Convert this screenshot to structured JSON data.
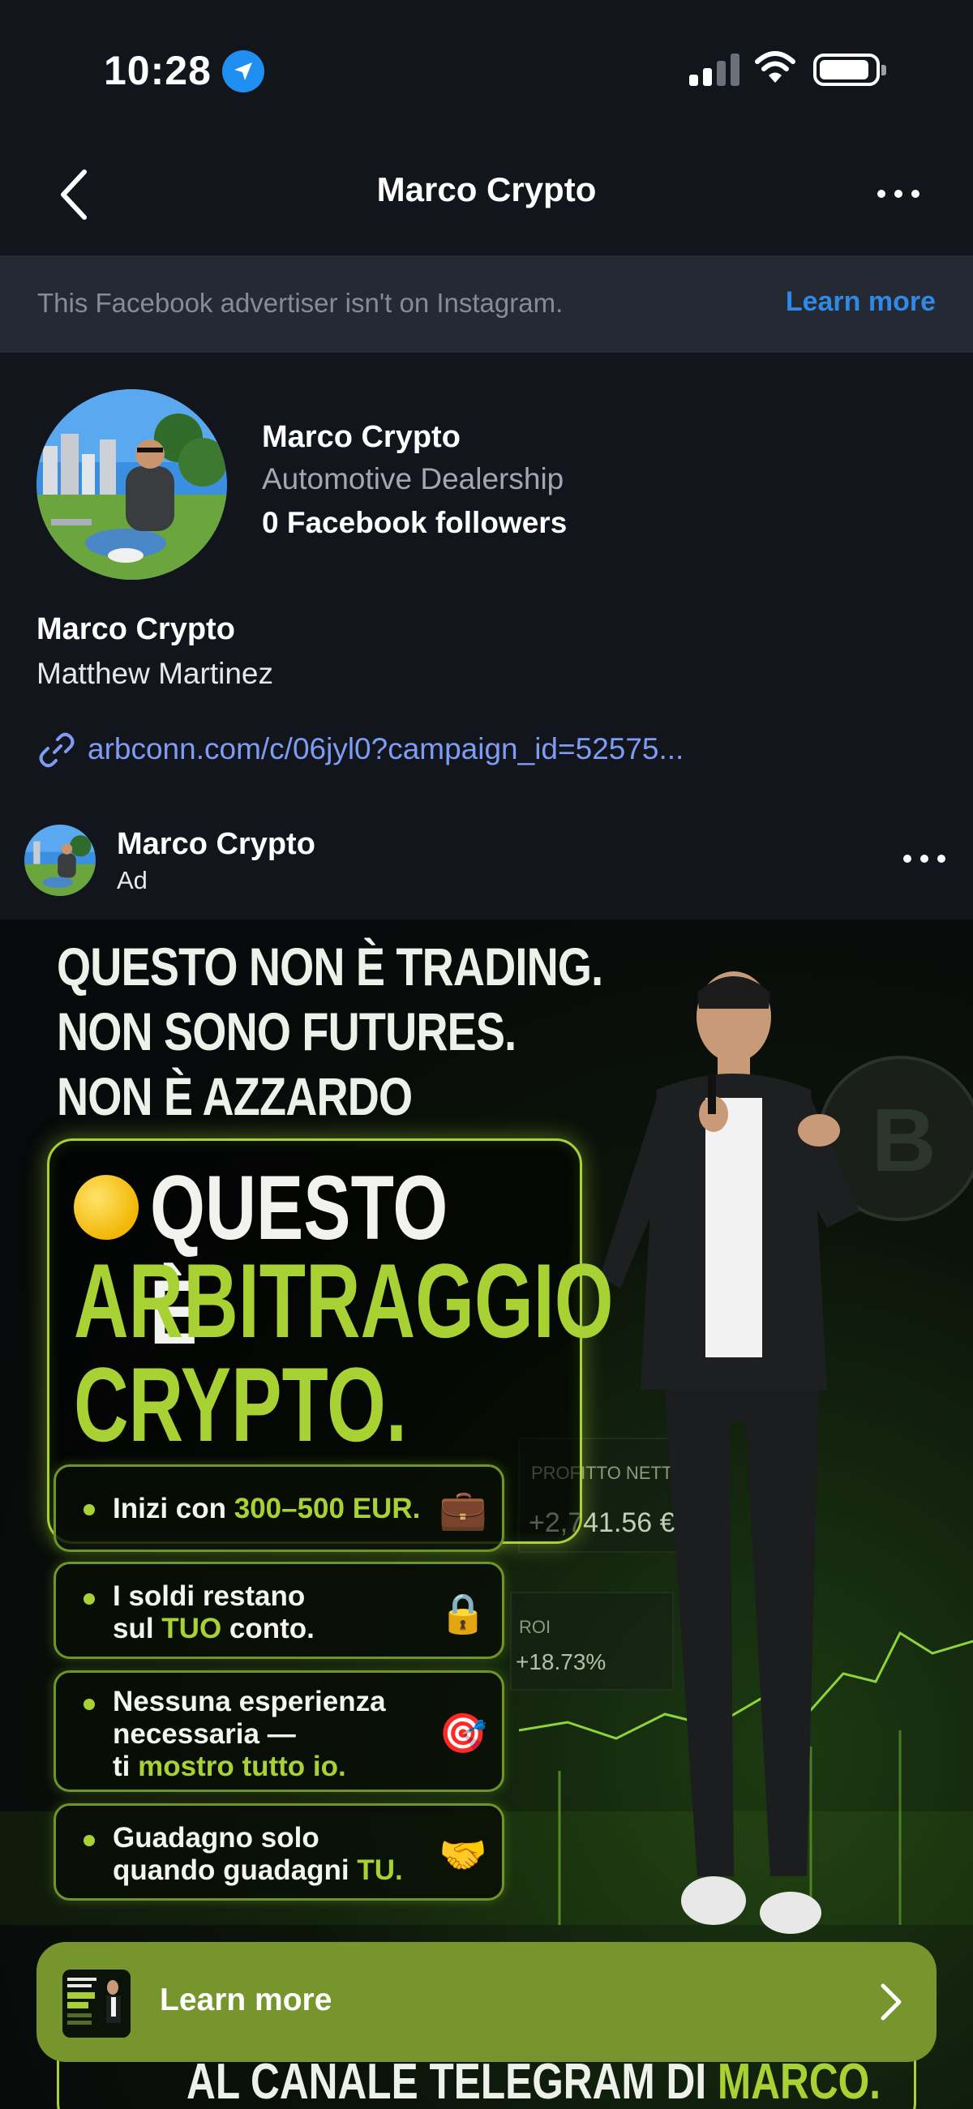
{
  "status_bar": {
    "time": "10:28",
    "icons": [
      "location-arrow-icon",
      "cellular-signal-icon",
      "wifi-icon",
      "battery-icon"
    ]
  },
  "nav": {
    "title": "Marco Crypto",
    "back_icon": "chevron-left-icon",
    "more_icon": "ellipsis-icon"
  },
  "notice": {
    "text": "This Facebook advertiser isn't on Instagram.",
    "link": "Learn more"
  },
  "profile": {
    "name": "Marco Crypto",
    "category": "Automotive Dealership",
    "followers": "0 Facebook followers",
    "page_name": "Marco Crypto",
    "owner": "Matthew Martinez",
    "link": "arbconn.com/c/06jyl0?campaign_id=52575..."
  },
  "ad": {
    "name": "Marco Crypto",
    "label": "Ad",
    "creative": {
      "headline": [
        "QUESTO NON È TRADING.",
        "NON SONO FUTURES.",
        "NON È AZZARDO"
      ],
      "big_white": "QUESTO È",
      "big_green_1": "ARBITRAGGIO",
      "big_green_2": "CRYPTO.",
      "bullets": [
        {
          "pre": "Inizi con ",
          "hl": "300–500 EUR.",
          "post": "",
          "emoji": "💼"
        },
        {
          "pre": "I soldi restano",
          "line2_pre": "sul ",
          "hl": "TUO",
          "post": " conto.",
          "emoji": "🔒"
        },
        {
          "pre": "Nessuna esperienza",
          "line2": "necessaria —",
          "line3_pre": "ti ",
          "hl": "mostro tutto io.",
          "emoji": "🎯"
        },
        {
          "pre": "Guadagno solo",
          "line2_pre": "quando guadagni ",
          "hl": "TU.",
          "emoji": "🤝"
        }
      ],
      "chart_labels": {
        "profit_label": "PROFITTO NETTO",
        "profit_value": "+2,741.56 €",
        "roi_label": "ROI",
        "roi_value": "+18.73%"
      },
      "telegram_pre": "AL CANALE TELEGRAM DI ",
      "telegram_hl": "MARCO.",
      "colors": {
        "accent_green": "#a8d234",
        "cta_green": "#76952d"
      }
    },
    "cta": {
      "label": "Learn more",
      "icon": "chevron-right-icon"
    }
  }
}
